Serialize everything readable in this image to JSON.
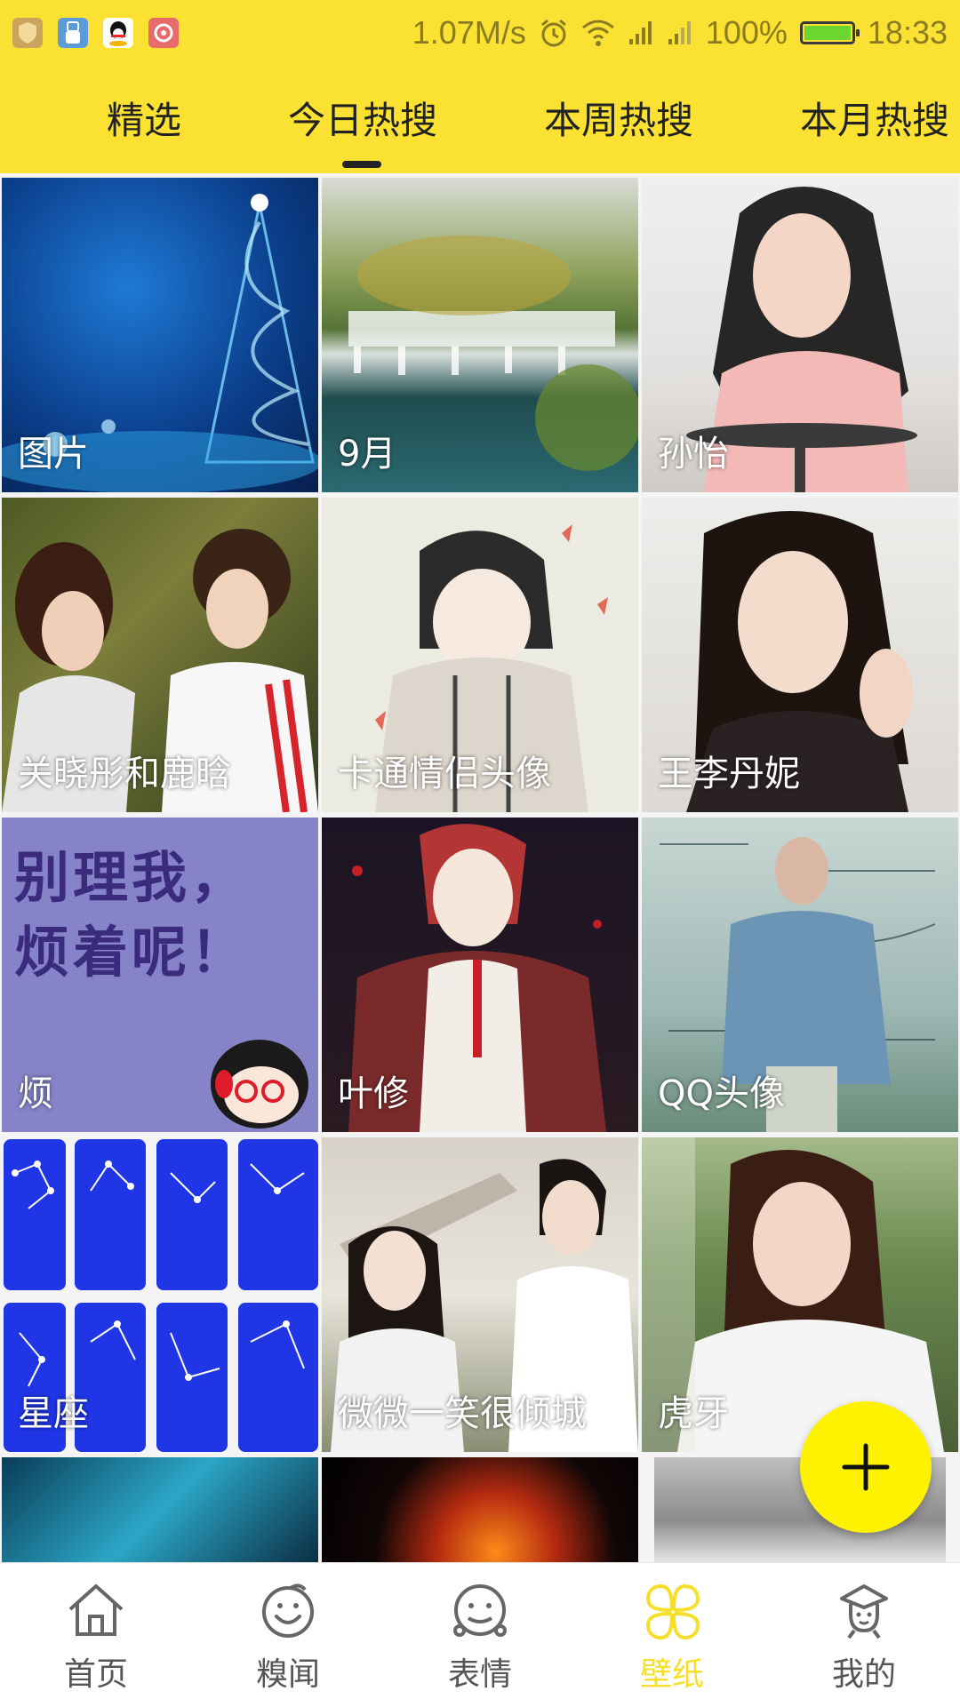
{
  "status_bar": {
    "speed": "1.07M/s",
    "battery": "100%",
    "time": "18:33",
    "battery_color": "#6bd62f"
  },
  "tabs": [
    {
      "label": "精选",
      "active": false
    },
    {
      "label": "今日热搜",
      "active": true
    },
    {
      "label": "本周热搜",
      "active": false
    },
    {
      "label": "本月热搜",
      "active": false
    }
  ],
  "wallpapers": [
    {
      "label": "图片",
      "theme": "christmas-tree-blue"
    },
    {
      "label": "9月",
      "theme": "waterfall-landscape"
    },
    {
      "label": "孙怡",
      "theme": "portrait-woman"
    },
    {
      "label": "关晓彤和鹿晗",
      "theme": "couple-photo"
    },
    {
      "label": "卡通情侣头像",
      "theme": "anime-boy"
    },
    {
      "label": "王李丹妮",
      "theme": "portrait-woman-dark"
    },
    {
      "label": "烦",
      "theme": "purple-text-cartoon",
      "image_text": [
        "别理我，",
        "烦着呢！"
      ]
    },
    {
      "label": "叶修",
      "theme": "anime-character-dark"
    },
    {
      "label": "QQ头像",
      "theme": "math-board-boy"
    },
    {
      "label": "星座",
      "theme": "zodiac-blue-cards"
    },
    {
      "label": "微微一笑很倾城",
      "theme": "drama-couple"
    },
    {
      "label": "虎牙",
      "theme": "outdoor-portrait"
    },
    {
      "label": "",
      "theme": "teal-light"
    },
    {
      "label": "",
      "theme": "fire-dark"
    },
    {
      "label": "",
      "theme": "gray-portrait"
    }
  ],
  "fab": {
    "icon": "plus-icon",
    "color": "#fff200"
  },
  "bottom_nav": [
    {
      "label": "首页",
      "icon": "home-icon",
      "active": false
    },
    {
      "label": "糗闻",
      "icon": "smile-face-icon",
      "active": false
    },
    {
      "label": "表情",
      "icon": "emoji-face-icon",
      "active": false
    },
    {
      "label": "壁纸",
      "icon": "clover-icon",
      "active": true
    },
    {
      "label": "我的",
      "icon": "profile-icon",
      "active": false
    }
  ],
  "accent_color": "#fbe232"
}
